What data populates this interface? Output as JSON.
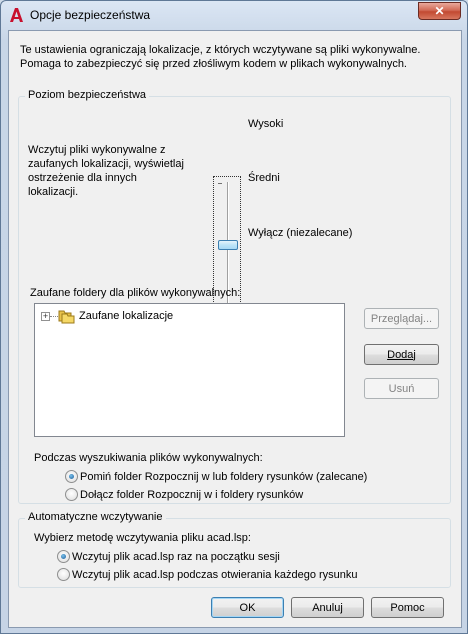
{
  "window": {
    "title": "Opcje bezpieczeństwa",
    "close_glyph": "✕"
  },
  "intro_text": "Te ustawienia ograniczają lokalizacje, z których wczytywane są pliki wykonywalne. Pomaga to zabezpieczyć się przed złośliwym kodem w plikach wykonywalnych.",
  "security_level": {
    "legend": "Poziom bezpieczeństwa",
    "description": "Wczytuj pliki wykonywalne z zaufanych lokalizacji, wyświetlaj ostrzeżenie dla innych lokalizacji.",
    "levels": [
      "Wysoki",
      "Średni",
      "Wyłącz (niezalecane)"
    ],
    "selected_level": "Średni",
    "trusted_folders_label": "Zaufane foldery dla plików wykonywalnych:",
    "tree_item": "Zaufane lokalizacje",
    "tree_expander": "+",
    "buttons": {
      "browse": "Przeglądaj...",
      "add": "Dodaj",
      "remove": "Usuń"
    },
    "search_label": "Podczas wyszukiwania plików wykonywalnych:",
    "search_options": [
      {
        "label": "Pomiń folder Rozpocznij w lub foldery rysunków (zalecane)",
        "checked": true
      },
      {
        "label": "Dołącz folder Rozpocznij w i foldery rysunków",
        "checked": false
      }
    ]
  },
  "autoload": {
    "legend": "Automatyczne wczytywanie",
    "method_label": "Wybierz metodę wczytywania pliku acad.lsp:",
    "options": [
      {
        "label": "Wczytuj plik acad.lsp raz na początku sesji",
        "checked": true
      },
      {
        "label": "Wczytuj plik acad.lsp podczas otwierania każdego rysunku",
        "checked": false
      }
    ]
  },
  "footer": {
    "ok": "OK",
    "cancel": "Anuluj",
    "help": "Pomoc"
  },
  "colors": {
    "app_icon_red": "#c8102e",
    "close_button": "#c24a32",
    "selection_blue": "#3c7fb1"
  }
}
